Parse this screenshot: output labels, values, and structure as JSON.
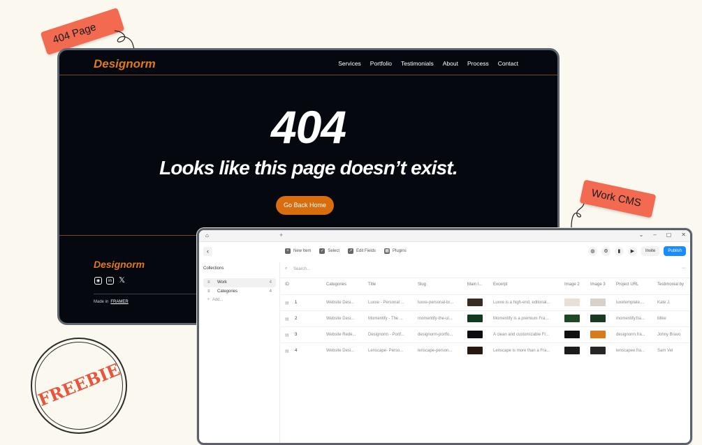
{
  "tags": {
    "page404": "404 Page",
    "work_cms": "Work CMS"
  },
  "stamp": {
    "text": "FREEBIE"
  },
  "site": {
    "logo": "Designorm",
    "nav": [
      "Services",
      "Portfolio",
      "Testimonials",
      "About",
      "Process",
      "Contact"
    ],
    "error_code": "404",
    "message": "Looks like this page doesn’t exist.",
    "button": "Go Back Home",
    "footer_logo": "Designorm",
    "made_in": "Made in",
    "made_in_link": "FRAMER",
    "accent": "#e07a18"
  },
  "cms": {
    "toolbar": {
      "new_item": "New Item",
      "select": "Select",
      "edit_fields": "Edit Fields",
      "plugins": "Plugins",
      "invite": "Invite",
      "publish": "Publish"
    },
    "sidebar": {
      "title": "Collections",
      "items": [
        {
          "label": "Work",
          "count": "4"
        },
        {
          "label": "Categories",
          "count": "4"
        }
      ],
      "add": "Add..."
    },
    "search_placeholder": "Search...",
    "columns": [
      "ID",
      "Categories",
      "Title",
      "Slug",
      "Main I...",
      "Excerpt",
      "Image 2",
      "Image 3",
      "Project URL",
      "Testimonial by"
    ],
    "rows": [
      {
        "id": "1",
        "category": "Website Desi...",
        "title": "Luxxe - Personal ...",
        "slug": "luxxe-personal-br...",
        "excerpt": "Luxxe is a high-end, editorial...",
        "url": "luxetemplate....",
        "testimonial": "Kate J."
      },
      {
        "id": "2",
        "category": "Website Desi...",
        "title": "Momentify - The ...",
        "slug": "momentify-the-ul...",
        "excerpt": "Momentify is a premium Fra...",
        "url": "momentify.fra...",
        "testimonial": "Mike"
      },
      {
        "id": "3",
        "category": "Website Rede...",
        "title": "Designorm - Portf...",
        "slug": "designorm-portfo...",
        "excerpt": "A clean and customizable Fr...",
        "url": "designorm.fra...",
        "testimonial": "Johny Bravo"
      },
      {
        "id": "4",
        "category": "Website Desi...",
        "title": "Lenscape- Perso...",
        "slug": "lenscape-person...",
        "excerpt": "Lenscape is more than a Fra...",
        "url": "lenscapee.fra...",
        "testimonial": "Sam Vel"
      }
    ]
  }
}
